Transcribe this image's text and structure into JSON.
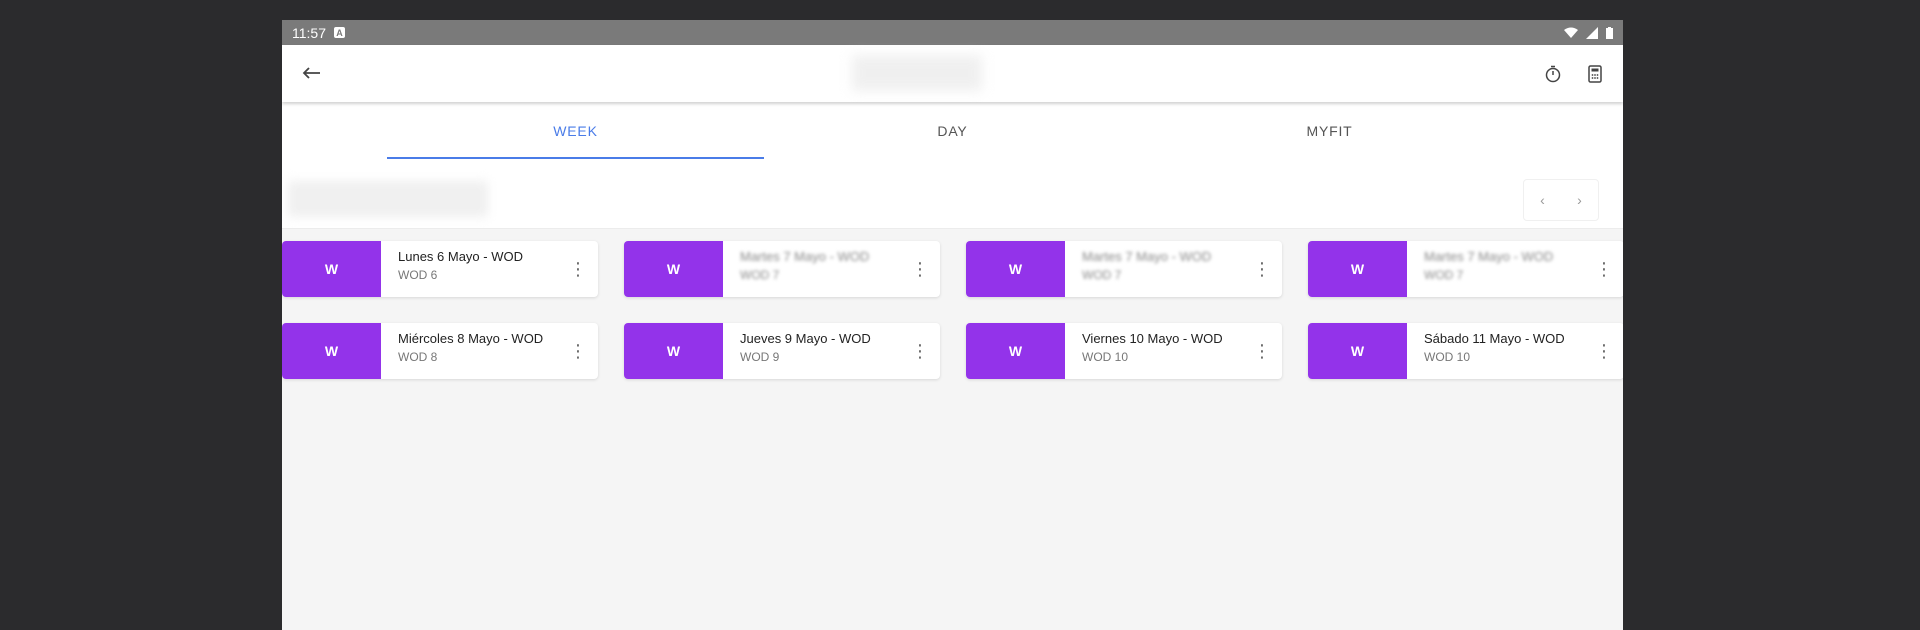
{
  "status_bar": {
    "time": "11:57",
    "badge": "A"
  },
  "tabs": [
    {
      "label": "WEEK",
      "active": true
    },
    {
      "label": "DAY",
      "active": false
    },
    {
      "label": "MYFIT",
      "active": false
    }
  ],
  "nav": {
    "prev": "‹",
    "next": "›"
  },
  "cards": [
    {
      "badge": "W",
      "title": "Lunes 6 Mayo - WOD",
      "subtitle": "WOD 6",
      "blurred": false
    },
    {
      "badge": "W",
      "title": "Martes 7 Mayo - WOD",
      "subtitle": "WOD 7",
      "blurred": true
    },
    {
      "badge": "W",
      "title": "Martes 7 Mayo - WOD",
      "subtitle": "WOD 7",
      "blurred": true
    },
    {
      "badge": "W",
      "title": "Martes 7 Mayo - WOD",
      "subtitle": "WOD 7",
      "blurred": true
    },
    {
      "badge": "W",
      "title": "Miércoles 8 Mayo - WOD",
      "subtitle": "WOD 8",
      "blurred": false
    },
    {
      "badge": "W",
      "title": "Jueves 9 Mayo - WOD",
      "subtitle": "WOD 9",
      "blurred": false
    },
    {
      "badge": "W",
      "title": "Viernes 10 Mayo - WOD",
      "subtitle": "WOD 10",
      "blurred": false
    },
    {
      "badge": "W",
      "title": "Sábado 11 Mayo - WOD",
      "subtitle": "WOD 10",
      "blurred": false
    }
  ],
  "colors": {
    "accent": "#9333ea",
    "tab_active": "#4a7ce8"
  },
  "icons": {
    "back": "back-arrow-icon",
    "timer": "timer-icon",
    "calculator": "calculator-icon",
    "more": "more-vert-icon"
  }
}
